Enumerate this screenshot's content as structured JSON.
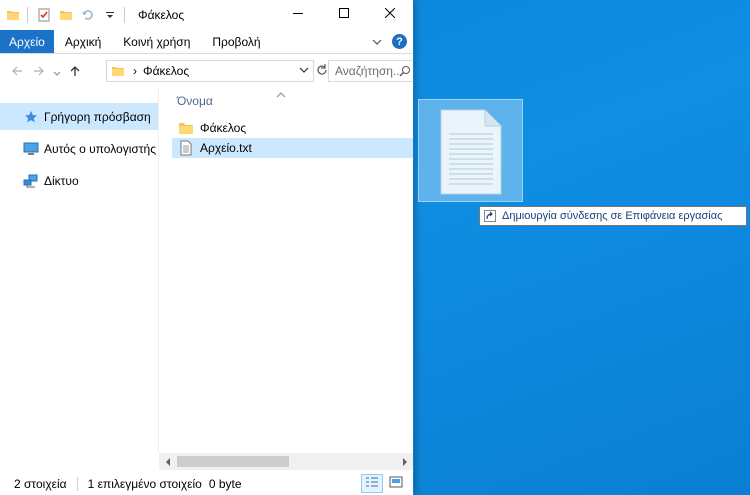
{
  "window": {
    "title": "Φάκελος",
    "quick_access_toolbar": [
      "folder-icon",
      "properties-icon",
      "new-folder-icon",
      "undo-icon",
      "dropdown-icon"
    ],
    "controls": [
      "minimize-icon",
      "maximize-icon",
      "close-icon"
    ]
  },
  "ribbon": {
    "tabs": [
      "Αρχείο",
      "Αρχική",
      "Κοινή χρήση",
      "Προβολή"
    ],
    "help": "?"
  },
  "navigation": {
    "breadcrumb_separator": "›",
    "path": "Φάκελος",
    "search_placeholder": "Αναζήτηση..."
  },
  "nav_pane": {
    "items": [
      {
        "label": "Γρήγορη πρόσβαση",
        "icon": "star-icon"
      },
      {
        "label": "Αυτός ο υπολογιστής",
        "icon": "computer-icon"
      },
      {
        "label": "Δίκτυο",
        "icon": "network-icon"
      }
    ]
  },
  "content": {
    "column_header": "Όνομα",
    "files": [
      {
        "name": "Φάκελος",
        "type": "folder"
      },
      {
        "name": "Αρχείο.txt",
        "type": "text-file"
      }
    ]
  },
  "status": {
    "item_count": "2 στοιχεία",
    "selection": "1 επιλεγμένο στοιχείο",
    "size": "0 byte"
  },
  "drag": {
    "tooltip": "Δημιουργία σύνδεσης σε Επιφάνεια εργασίας"
  },
  "colors": {
    "desktop": "#0f86d9",
    "accent": "#1a73c7",
    "selection": "#cce8ff"
  }
}
